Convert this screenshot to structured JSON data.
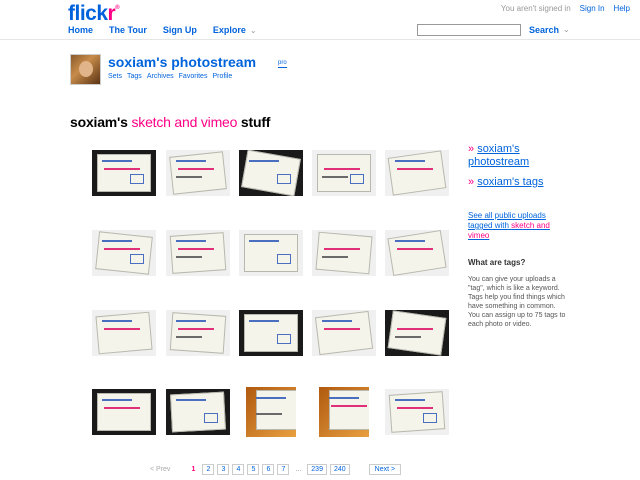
{
  "header": {
    "logo_left": "flick",
    "logo_right": "r",
    "logo_tm": "®",
    "signed_out_text": "You aren't signed in",
    "sign_in": "Sign In",
    "help": "Help",
    "nav": [
      "Home",
      "The Tour",
      "Sign Up",
      "Explore"
    ],
    "search_label": "Search",
    "search_value": ""
  },
  "user": {
    "photostream_title": "soxiam's photostream",
    "pro_badge": "pro",
    "subnav": [
      "Sets",
      "Tags",
      "Archives",
      "Favorites",
      "Profile"
    ]
  },
  "page": {
    "title_owner": "soxiam's",
    "title_tag": "sketch and vimeo",
    "title_suffix": "stuff"
  },
  "sidebar": {
    "link_photostream": "soxiam's photostream",
    "link_tags": "soxiam's tags",
    "see_all_prefix": "See all public uploads tagged with",
    "see_all_tag": "sketch and vimeo",
    "what_are_tags_heading": "What are tags?",
    "what_are_tags_body": "You can give your uploads a \"tag\", which is like a keyword. Tags help you find things which have something in common. You can assign up to 75 tags to each photo or video."
  },
  "pagination": {
    "prev": "< Prev",
    "current": "1",
    "pages": [
      "2",
      "3",
      "4",
      "5",
      "6",
      "7"
    ],
    "ellipsis": "...",
    "tail_pages": [
      "239",
      "240"
    ],
    "next": "Next >"
  }
}
